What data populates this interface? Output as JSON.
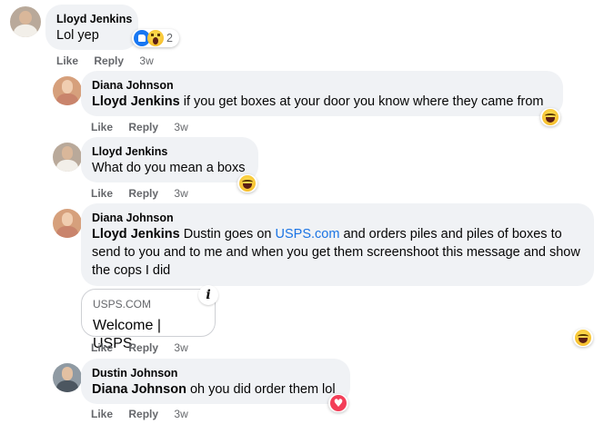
{
  "comments": [
    {
      "author": "Lloyd Jenkins",
      "text": "Lol yep",
      "reactions": {
        "icons": [
          "like-icon",
          "wow-icon"
        ],
        "count": "2"
      },
      "actions": {
        "like": "Like",
        "reply": "Reply",
        "time": "3w"
      }
    },
    {
      "author": "Diana Johnson",
      "mention": "Lloyd Jenkins",
      "text": " if you get boxes at your door you know where they came from",
      "reactions": {
        "icons": [
          "haha-icon"
        ]
      },
      "actions": {
        "like": "Like",
        "reply": "Reply",
        "time": "3w"
      }
    },
    {
      "author": "Lloyd Jenkins",
      "text": "What do you mean a boxs",
      "reactions": {
        "icons": [
          "haha-icon"
        ]
      },
      "actions": {
        "like": "Like",
        "reply": "Reply",
        "time": "3w"
      }
    },
    {
      "author": "Diana Johnson",
      "mention": "Lloyd Jenkins",
      "text_before_link": " Dustin goes on ",
      "link": "USPS.com",
      "text_after_link": " and orders piles and piles of boxes to send to you and to me and when you get them screenshoot this message and show the cops I did",
      "link_preview": {
        "domain": "USPS.COM",
        "title": "Welcome | USPS",
        "info_icon": "info-icon"
      },
      "reactions": {
        "icons": [
          "haha-icon"
        ]
      },
      "actions": {
        "like": "Like",
        "reply": "Reply",
        "time": "3w"
      }
    },
    {
      "author": "Dustin Johnson",
      "mention": "Diana Johnson",
      "text": " oh you did order them lol",
      "reactions": {
        "icons": [
          "love-icon"
        ]
      },
      "actions": {
        "like": "Like",
        "reply": "Reply",
        "time": "3w"
      }
    }
  ],
  "colors": {
    "bubble": "#f0f2f5",
    "link": "#1b74e4",
    "meta": "#65676b",
    "like": "#1877f2",
    "love": "#f33e58"
  }
}
